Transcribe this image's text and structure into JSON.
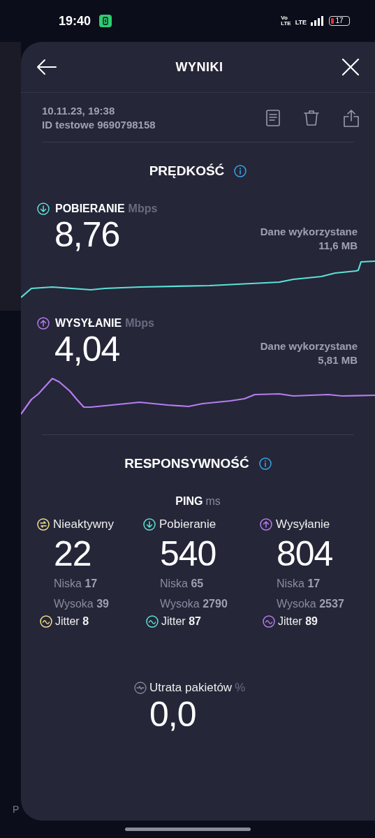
{
  "status_bar": {
    "time": "19:40",
    "volte_top": "Vo",
    "volte_bottom": "LTE",
    "network_type": "LTE",
    "battery_percent": "17"
  },
  "background": {
    "cut_text": "P"
  },
  "header": {
    "title": "WYNIKI"
  },
  "test_info": {
    "date": "10.11.23, 19:38",
    "test_id": "ID testowe 9690798158"
  },
  "speed": {
    "title": "PRĘDKOŚĆ",
    "sections": [
      {
        "kind": "download",
        "label": "POBIERANIE",
        "unit": "Mbps",
        "value": "8,76",
        "data_label": "Dane wykorzystane",
        "data_value": "11,6 MB",
        "color": "#5ce1d6"
      },
      {
        "kind": "upload",
        "label": "WYSYŁANIE",
        "unit": "Mbps",
        "value": "4,04",
        "data_label": "Dane wykorzystane",
        "data_value": "5,81 MB",
        "color": "#b67cf0"
      }
    ]
  },
  "responsiveness": {
    "title": "RESPONSYWNOŚĆ",
    "ping_label": "PING",
    "ping_unit": "ms",
    "columns": [
      {
        "kind": "idle",
        "label": "Nieaktywny",
        "value": "22",
        "low_label": "Niska",
        "low": "17",
        "high_label": "Wysoka",
        "high": "39",
        "jitter_label": "Jitter",
        "jitter": "8",
        "color": "#f0e08a"
      },
      {
        "kind": "download",
        "label": "Pobieranie",
        "value": "540",
        "low_label": "Niska",
        "low": "65",
        "high_label": "Wysoka",
        "high": "2790",
        "jitter_label": "Jitter",
        "jitter": "87",
        "color": "#5ce1d6"
      },
      {
        "kind": "upload",
        "label": "Wysyłanie",
        "value": "804",
        "low_label": "Niska",
        "low": "17",
        "high_label": "Wysoka",
        "high": "2537",
        "jitter_label": "Jitter",
        "jitter": "89",
        "color": "#b67cf0"
      }
    ]
  },
  "packet_loss": {
    "label": "Utrata pakietów",
    "unit": "%",
    "value": "0,0"
  }
}
